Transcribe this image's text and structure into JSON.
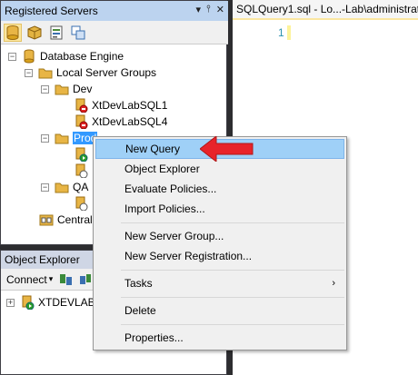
{
  "registered_servers": {
    "title": "Registered Servers",
    "title_controls": [
      "▾",
      "⫯",
      "✕"
    ],
    "tree": {
      "root": "Database Engine",
      "local_groups": "Local Server Groups",
      "dev": "Dev",
      "dev_servers": [
        "XtDevLabSQL1",
        "XtDevLabSQL4"
      ],
      "prod": "Prod",
      "qa": "QA",
      "central": "Central"
    }
  },
  "object_explorer": {
    "title": "Object Explorer",
    "connect_label": "Connect",
    "server": "XTDEVLAB"
  },
  "editor": {
    "tab_title": "SQLQuery1.sql - Lo...-Lab\\administrat",
    "line_number": "1"
  },
  "context_menu": {
    "items": {
      "new_query": "New Query",
      "object_explorer": "Object Explorer",
      "evaluate_policies": "Evaluate Policies...",
      "import_policies": "Import Policies...",
      "new_server_group": "New Server Group...",
      "new_server_registration": "New Server Registration...",
      "tasks": "Tasks",
      "delete": "Delete",
      "properties": "Properties..."
    },
    "submenu_arrow": "›"
  },
  "colors": {
    "highlight": "#9fd0f7",
    "annotation_arrow": "#e8232a",
    "folder": "#e8b545",
    "db": "#d9a21c"
  }
}
